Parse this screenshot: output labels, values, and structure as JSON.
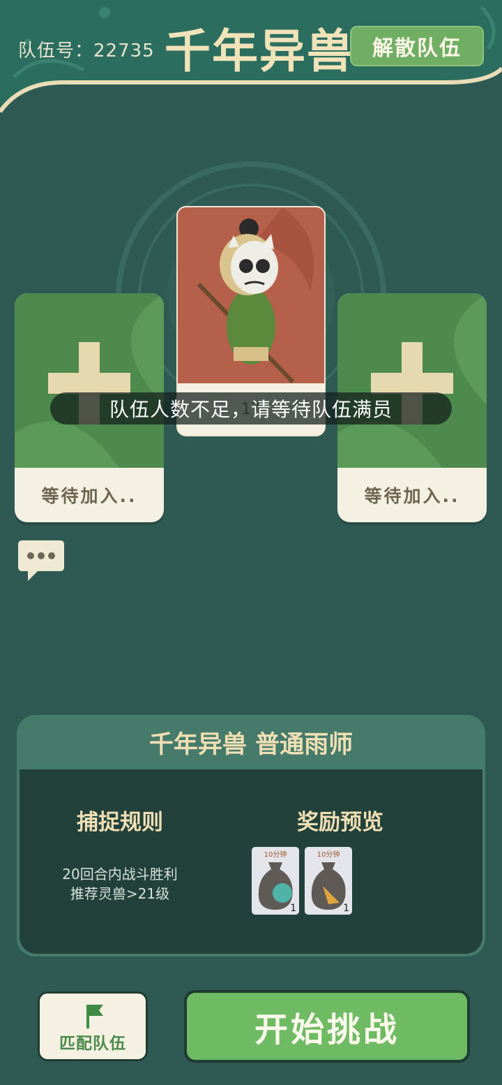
{
  "header": {
    "team_id_label": "队伍号：22735",
    "title": "千年异兽",
    "disband_label": "解散队伍"
  },
  "slots": {
    "left_wait": "等待加入..",
    "right_wait": "等待加入..",
    "center_level": "17"
  },
  "toast": "队伍人数不足，请等待队伍满员",
  "panel": {
    "title": "千年异兽  普通雨师",
    "rules_heading": "捕捉规则",
    "rule_line1": "20回合内战斗胜利",
    "rule_line2": "推荐灵兽>21级",
    "rewards_heading": "奖励预览",
    "rewards": [
      {
        "time": "10分钟",
        "count": "1"
      },
      {
        "time": "10分钟",
        "count": "1"
      }
    ]
  },
  "buttons": {
    "match_label": "匹配队伍",
    "start_label": "开始挑战"
  },
  "colors": {
    "background": "#2e5a53",
    "accent_green": "#6fae63",
    "gold_text": "#f0dfb4",
    "card_red": "#b5604a"
  }
}
